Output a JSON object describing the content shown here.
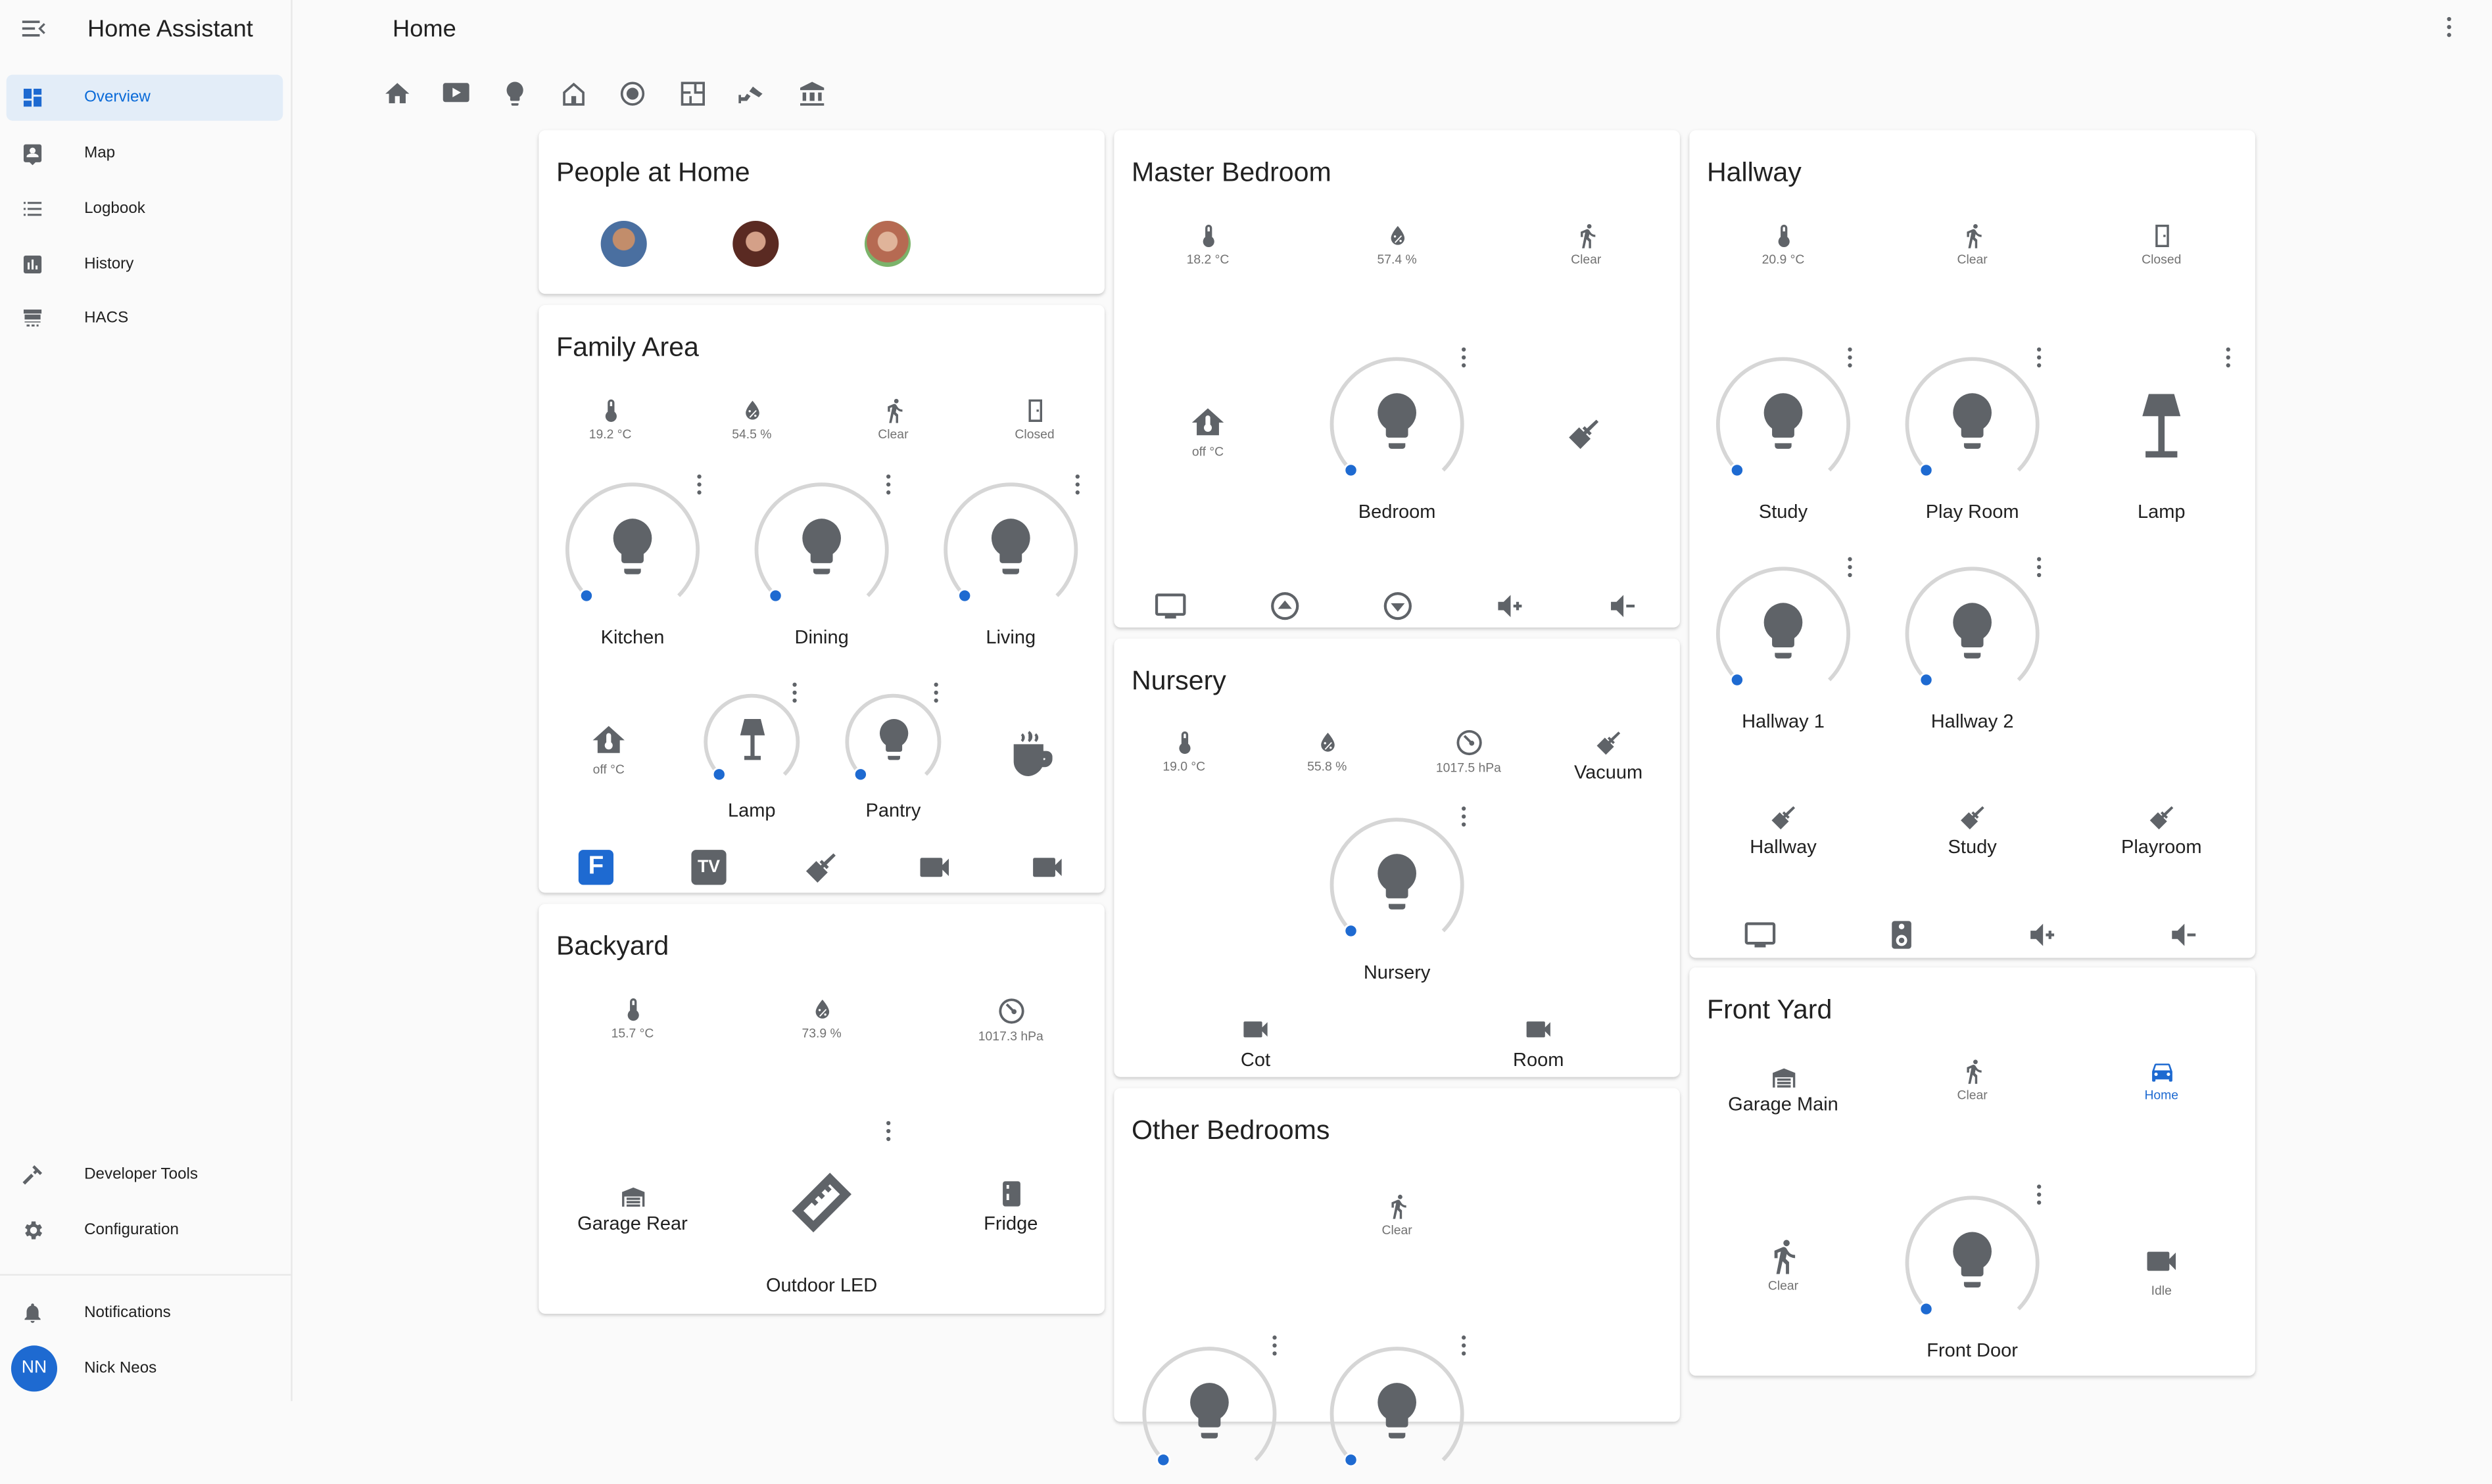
{
  "app": {
    "title": "Home Assistant",
    "page_title": "Home"
  },
  "sidebar": {
    "items": [
      {
        "label": "Overview",
        "icon": "dashboard-icon",
        "active": true
      },
      {
        "label": "Map",
        "icon": "map-account-icon"
      },
      {
        "label": "Logbook",
        "icon": "logbook-list-icon"
      },
      {
        "label": "History",
        "icon": "history-chart-icon"
      },
      {
        "label": "HACS",
        "icon": "hacs-store-icon"
      }
    ],
    "bottom_items": [
      {
        "label": "Developer Tools",
        "icon": "hammer-icon"
      },
      {
        "label": "Configuration",
        "icon": "cog-icon"
      }
    ],
    "notifications": "Notifications",
    "user": {
      "initials": "NN",
      "name": "Nick Neos"
    }
  },
  "tabs": [
    "home-icon",
    "media-player-icon",
    "lightbulb-icon",
    "home-outline-icon",
    "robot-vacuum-icon",
    "floor-plan-icon",
    "cctv-icon",
    "bank-icon"
  ],
  "colors": {
    "accent": "#1e6ad1",
    "icon": "#5f6368",
    "text_secondary": "#727272"
  },
  "cards": {
    "people": {
      "title": "People at Home"
    },
    "family": {
      "title": "Family Area",
      "sensors": [
        {
          "icon": "thermometer-icon",
          "value": "19.2 °C"
        },
        {
          "icon": "water-percent-icon",
          "value": "54.5 %"
        },
        {
          "icon": "walk-icon",
          "value": "Clear"
        },
        {
          "icon": "door-closed-icon",
          "value": "Closed"
        }
      ],
      "lights": [
        "Kitchen",
        "Dining",
        "Living"
      ],
      "thermostat": "off °C",
      "lamp": "Lamp",
      "pantry": "Pantry"
    },
    "backyard": {
      "title": "Backyard",
      "sensors": [
        {
          "icon": "thermometer-icon",
          "value": "15.7 °C"
        },
        {
          "icon": "water-percent-icon",
          "value": "73.9 %"
        },
        {
          "icon": "gauge-icon",
          "value": "1017.3 hPa"
        }
      ],
      "garage_rear": "Garage Rear",
      "fridge": "Fridge",
      "outdoor_led": "Outdoor LED"
    },
    "master": {
      "title": "Master Bedroom",
      "sensors": [
        {
          "icon": "thermometer-icon",
          "value": "18.2 °C"
        },
        {
          "icon": "water-percent-icon",
          "value": "57.4 %"
        },
        {
          "icon": "walk-icon",
          "value": "Clear"
        }
      ],
      "thermostat": "off °C",
      "light": "Bedroom"
    },
    "nursery": {
      "title": "Nursery",
      "sensors": [
        {
          "icon": "thermometer-icon",
          "value": "19.0 °C"
        },
        {
          "icon": "water-percent-icon",
          "value": "55.8 %"
        },
        {
          "icon": "gauge-icon",
          "value": "1017.5 hPa"
        }
      ],
      "vacuum": "Vacuum",
      "light": "Nursery",
      "cameras": [
        "Cot",
        "Room"
      ]
    },
    "other": {
      "title": "Other Bedrooms",
      "motion": "Clear"
    },
    "hallway": {
      "title": "Hallway",
      "sensors": [
        {
          "icon": "thermometer-icon",
          "value": "20.9 °C"
        },
        {
          "icon": "walk-icon",
          "value": "Clear"
        },
        {
          "icon": "door-closed-icon",
          "value": "Closed"
        }
      ],
      "lights": [
        "Study",
        "Play Room",
        "Lamp",
        "Hallway 1",
        "Hallway 2"
      ],
      "vacuums": [
        "Hallway",
        "Study",
        "Playroom"
      ]
    },
    "front": {
      "title": "Front Yard",
      "garage": "Garage Main",
      "motion": "Clear",
      "car": "Home",
      "motion2": "Clear",
      "camera": "Idle",
      "light": "Front Door"
    }
  }
}
